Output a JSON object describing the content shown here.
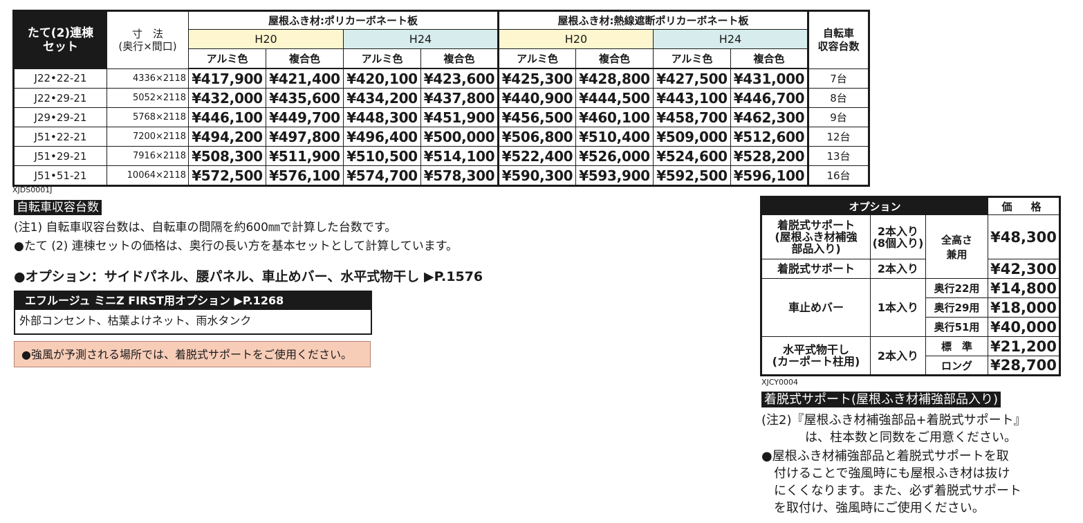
{
  "main_table": {
    "corner_label_1": "たて(2)連棟",
    "corner_label_2": "セット",
    "dim_label_1": "寸　法",
    "dim_label_2": "(奥行×間口)",
    "group_1": "屋根ふき材:ポリカーボネート板",
    "group_2": "屋根ふき材:熱線遮断ポリカーボネート板",
    "sub_h20": "H20",
    "sub_h24": "H24",
    "col_alumi": "アルミ色",
    "col_fukugo": "複合色",
    "bike_label_1": "自転車",
    "bike_label_2": "収容台数",
    "rows": [
      {
        "model": "J22•22-21",
        "dim": "4336×2118",
        "prices": [
          "¥417,900",
          "¥421,400",
          "¥420,100",
          "¥423,600",
          "¥425,300",
          "¥428,800",
          "¥427,500",
          "¥431,000"
        ],
        "capacity": "7台"
      },
      {
        "model": "J22•29-21",
        "dim": "5052×2118",
        "prices": [
          "¥432,000",
          "¥435,600",
          "¥434,200",
          "¥437,800",
          "¥440,900",
          "¥444,500",
          "¥443,100",
          "¥446,700"
        ],
        "capacity": "8台"
      },
      {
        "model": "J29•29-21",
        "dim": "5768×2118",
        "prices": [
          "¥446,100",
          "¥449,700",
          "¥448,300",
          "¥451,900",
          "¥456,500",
          "¥460,100",
          "¥458,700",
          "¥462,300"
        ],
        "capacity": "9台"
      },
      {
        "model": "J51•22-21",
        "dim": "7200×2118",
        "prices": [
          "¥494,200",
          "¥497,800",
          "¥496,400",
          "¥500,000",
          "¥506,800",
          "¥510,400",
          "¥509,000",
          "¥512,600"
        ],
        "capacity": "12台"
      },
      {
        "model": "J51•29-21",
        "dim": "7916×2118",
        "prices": [
          "¥508,300",
          "¥511,900",
          "¥510,500",
          "¥514,100",
          "¥522,400",
          "¥526,000",
          "¥524,600",
          "¥528,200"
        ],
        "capacity": "13台"
      },
      {
        "model": "J51•51-21",
        "dim": "10064×2118",
        "prices": [
          "¥572,500",
          "¥576,100",
          "¥574,700",
          "¥578,300",
          "¥590,300",
          "¥593,900",
          "¥592,500",
          "¥596,100"
        ],
        "capacity": "16台"
      }
    ],
    "code": "XJDS0001J"
  },
  "left_notes": {
    "section_tag": "自転車収容台数",
    "note1": "(注1) 自転車収容台数は、自転車の間隔を約600㎜で計算した台数です。",
    "note2": "●たて (2) 連棟セットの価格は、奥行の長い方を基本セットとして計算しています。",
    "option_line": "●オプション：サイドパネル、腰パネル、車止めバー、水平式物干し ▶P.1576",
    "efu_head": "エフルージュ ミニZ FIRST用オプション ▶P.1268",
    "efu_body": "外部コンセント、枯葉よけネット、雨水タンク",
    "warning": "●強風が予測される場所では、着脱式サポートをご使用ください。"
  },
  "option_table": {
    "head_option": "オプション",
    "head_price": "価　格",
    "rows": {
      "support_reinforced_name": [
        "着脱式サポート",
        "(屋根ふき材補強",
        "部品入り)"
      ],
      "support_reinforced_qty": [
        "2本入り",
        "(8個入り)"
      ],
      "full_height": [
        "全高さ",
        "兼用"
      ],
      "support_reinforced_price": "¥48,300",
      "support_name": "着脱式サポート",
      "support_qty": "2本入り",
      "support_price": "¥42,300",
      "stopper_name": "車止めバー",
      "stopper_qty": "1本入り",
      "stopper_22": "奥行22用",
      "stopper_22_price": "¥14,800",
      "stopper_29": "奥行29用",
      "stopper_29_price": "¥18,000",
      "stopper_51": "奥行51用",
      "stopper_51_price": "¥40,000",
      "dryer_name": [
        "水平式物干し",
        "(カーポート柱用)"
      ],
      "dryer_qty": "2本入り",
      "dryer_std": "標　準",
      "dryer_std_price": "¥21,200",
      "dryer_long": "ロング",
      "dryer_long_price": "¥28,700"
    },
    "code": "XJCY0004"
  },
  "right_notes": {
    "section_tag": "着脱式サポート(屋根ふき材補強部品入り)",
    "note2_line1": "(注2)『屋根ふき材補強部品+着脱式サポート』",
    "note2_line2": "は、柱本数と同数をご用意ください。",
    "bullet_line1": "●屋根ふき材補強部品と着脱式サポートを取",
    "bullet_line2": "付けることで強風時にも屋根ふき材は抜け",
    "bullet_line3": "にくくなります。また、必ず着脱式サポート",
    "bullet_line4": "を取付け、強風時にご使用ください。"
  }
}
